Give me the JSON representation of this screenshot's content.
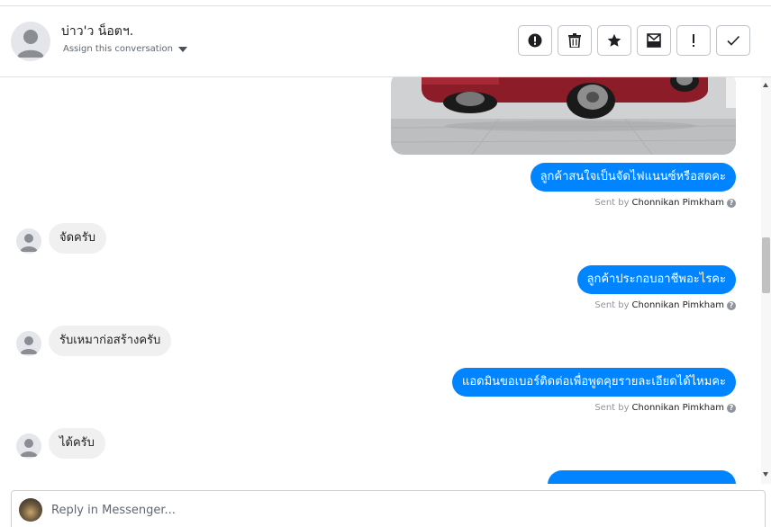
{
  "header": {
    "contact_name": "บ่าว'ว น็อตฯ.",
    "assign_label": "Assign this conversation",
    "actions": [
      {
        "icon": "alert-circle-icon"
      },
      {
        "icon": "trash-icon"
      },
      {
        "icon": "star-icon"
      },
      {
        "icon": "archive-envelope-icon"
      },
      {
        "icon": "exclamation-icon"
      },
      {
        "icon": "checkmark-icon"
      }
    ]
  },
  "conversation": {
    "sent_by_prefix": "Sent by",
    "agent_name": "Chonnikan Pimkham",
    "help_glyph": "?",
    "messages": [
      {
        "direction": "out",
        "text": "ลูกค้าสนใจเป็นจัดไฟแนนซ์หรือสดคะ"
      },
      {
        "direction": "in",
        "text": "จัดครับ"
      },
      {
        "direction": "out",
        "text": "ลูกค้าประกอบอาชีพอะไรคะ"
      },
      {
        "direction": "in",
        "text": "รับเหมาก่อสร้างครับ"
      },
      {
        "direction": "out",
        "text": "แอดมินขอเบอร์ติดต่อเพื่อพูดคุยรายละเอียดได้ไหมคะ"
      },
      {
        "direction": "in",
        "text": "ได้ครับ"
      }
    ]
  },
  "composer": {
    "placeholder": "Reply in Messenger..."
  },
  "colors": {
    "outgoing_bubble": "#0084ff",
    "incoming_bubble": "#f1f0f0",
    "border": "#dddfe2"
  }
}
